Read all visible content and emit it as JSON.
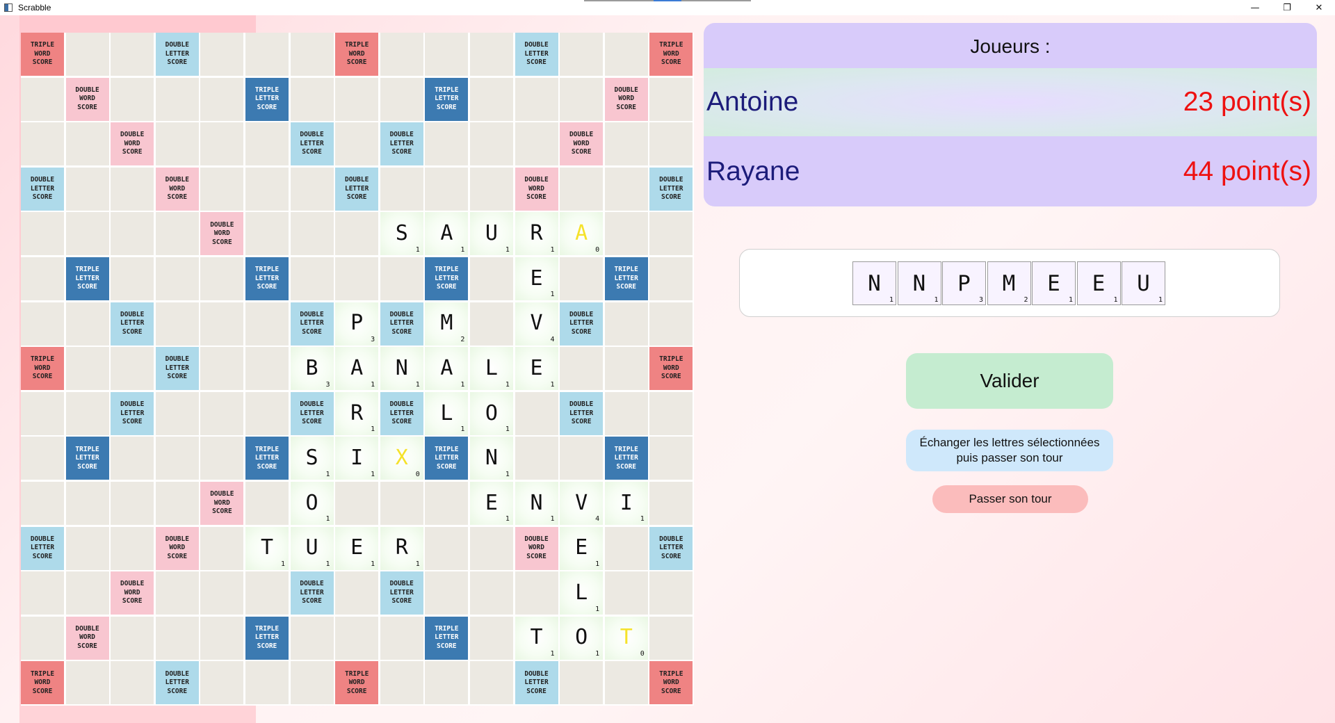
{
  "window": {
    "title": "Scrabble",
    "controls": {
      "minimize": "—",
      "maximize": "❐",
      "close": "✕"
    }
  },
  "colors": {
    "triple_word": "#ef8383",
    "double_word": "#f8c6d0",
    "double_letter": "#aedaea",
    "triple_letter": "#3c7ab1",
    "empty": "#ece9e2",
    "score_text": "#ee1111",
    "player_name": "#1c1c7a",
    "blank_tile_letter": "#f5e22b"
  },
  "bonus_labels": {
    "tw": "TRIPLE\nWORD\nSCORE",
    "dw": "DOUBLE\nWORD\nSCORE",
    "dl": "DOUBLE\nLETTER\nSCORE",
    "tl": "TRIPLE\nLETTER\nSCORE"
  },
  "board": {
    "bonus_grid": [
      "T..d...T...d..T",
      ".D...t...t...D.",
      "..D...d.d...D..",
      "d..D...d...D..d",
      "....D.....D....",
      ".t...t...t...t.",
      "..d...d.d...d..",
      "T..d...D...d..T",
      "..d...d.d...d..",
      ".t...t...t...t.",
      "....D.....D....",
      "d..D...d...D..d",
      "..D...d.d...D..",
      ".D...t...t...D.",
      "T..d...T...d..T"
    ],
    "tiles": [
      {
        "row": 4,
        "col": 8,
        "letter": "S",
        "points": "1"
      },
      {
        "row": 4,
        "col": 9,
        "letter": "A",
        "points": "1"
      },
      {
        "row": 4,
        "col": 10,
        "letter": "U",
        "points": "1"
      },
      {
        "row": 4,
        "col": 11,
        "letter": "R",
        "points": "1"
      },
      {
        "row": 4,
        "col": 12,
        "letter": "A",
        "points": "0",
        "blank": true
      },
      {
        "row": 5,
        "col": 11,
        "letter": "E",
        "points": "1"
      },
      {
        "row": 6,
        "col": 7,
        "letter": "P",
        "points": "3"
      },
      {
        "row": 6,
        "col": 9,
        "letter": "M",
        "points": "2"
      },
      {
        "row": 6,
        "col": 11,
        "letter": "V",
        "points": "4"
      },
      {
        "row": 7,
        "col": 6,
        "letter": "B",
        "points": "3"
      },
      {
        "row": 7,
        "col": 7,
        "letter": "A",
        "points": "1"
      },
      {
        "row": 7,
        "col": 8,
        "letter": "N",
        "points": "1"
      },
      {
        "row": 7,
        "col": 9,
        "letter": "A",
        "points": "1"
      },
      {
        "row": 7,
        "col": 10,
        "letter": "L",
        "points": "1"
      },
      {
        "row": 7,
        "col": 11,
        "letter": "E",
        "points": "1"
      },
      {
        "row": 8,
        "col": 7,
        "letter": "R",
        "points": "1"
      },
      {
        "row": 8,
        "col": 9,
        "letter": "L",
        "points": "1"
      },
      {
        "row": 8,
        "col": 10,
        "letter": "O",
        "points": "1"
      },
      {
        "row": 9,
        "col": 6,
        "letter": "S",
        "points": "1"
      },
      {
        "row": 9,
        "col": 7,
        "letter": "I",
        "points": "1"
      },
      {
        "row": 9,
        "col": 8,
        "letter": "X",
        "points": "0",
        "blank": true
      },
      {
        "row": 9,
        "col": 10,
        "letter": "N",
        "points": "1"
      },
      {
        "row": 10,
        "col": 6,
        "letter": "O",
        "points": "1"
      },
      {
        "row": 10,
        "col": 10,
        "letter": "E",
        "points": "1"
      },
      {
        "row": 10,
        "col": 11,
        "letter": "N",
        "points": "1"
      },
      {
        "row": 10,
        "col": 12,
        "letter": "V",
        "points": "4"
      },
      {
        "row": 10,
        "col": 13,
        "letter": "I",
        "points": "1"
      },
      {
        "row": 11,
        "col": 5,
        "letter": "T",
        "points": "1"
      },
      {
        "row": 11,
        "col": 6,
        "letter": "U",
        "points": "1"
      },
      {
        "row": 11,
        "col": 7,
        "letter": "E",
        "points": "1"
      },
      {
        "row": 11,
        "col": 8,
        "letter": "R",
        "points": "1"
      },
      {
        "row": 11,
        "col": 12,
        "letter": "E",
        "points": "1"
      },
      {
        "row": 12,
        "col": 12,
        "letter": "L",
        "points": "1"
      },
      {
        "row": 13,
        "col": 11,
        "letter": "T",
        "points": "1"
      },
      {
        "row": 13,
        "col": 12,
        "letter": "O",
        "points": "1"
      },
      {
        "row": 13,
        "col": 13,
        "letter": "T",
        "points": "0",
        "blank": true
      }
    ]
  },
  "players_panel": {
    "title": "Joueurs :",
    "players": [
      {
        "name": "Antoine",
        "score": "23 point(s)"
      },
      {
        "name": "Rayane",
        "score": "44 point(s)"
      }
    ]
  },
  "rack": [
    {
      "letter": "N",
      "points": "1"
    },
    {
      "letter": "N",
      "points": "1"
    },
    {
      "letter": "P",
      "points": "3"
    },
    {
      "letter": "M",
      "points": "2"
    },
    {
      "letter": "E",
      "points": "1"
    },
    {
      "letter": "E",
      "points": "1"
    },
    {
      "letter": "U",
      "points": "1"
    }
  ],
  "actions": {
    "validate": "Valider",
    "exchange": "Échanger les lettres sélectionnées\npuis passer son tour",
    "pass": "Passer son tour"
  }
}
